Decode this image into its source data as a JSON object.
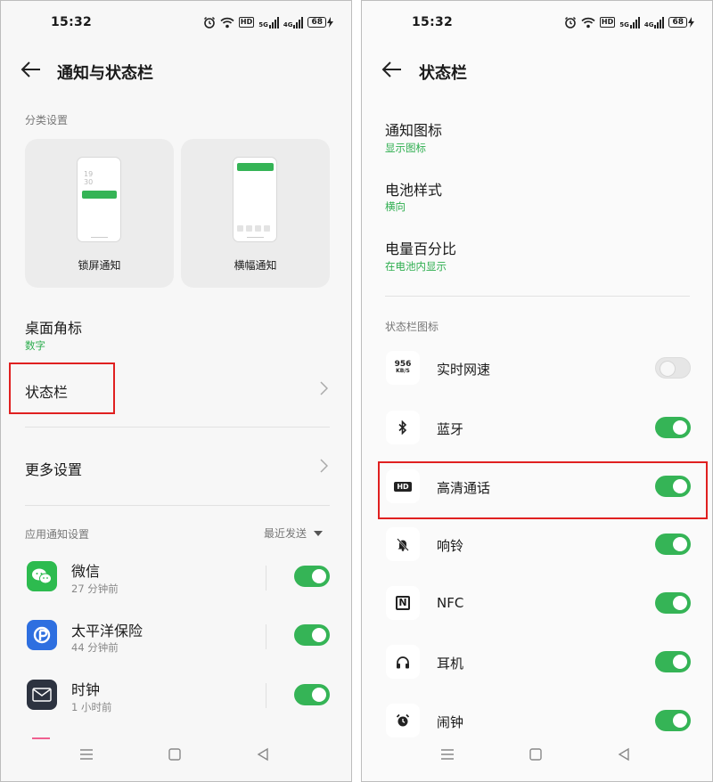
{
  "status": {
    "time": "15:32",
    "battery": "68",
    "hd": "HD",
    "sig1": "5G",
    "sig2": "4G"
  },
  "left": {
    "title": "通知与状态栏",
    "category_label": "分类设置",
    "cards": [
      {
        "label": "锁屏通知",
        "clock_top": "19",
        "clock_bottom": "30"
      },
      {
        "label": "横幅通知"
      }
    ],
    "badge": {
      "title": "桌面角标",
      "value": "数字"
    },
    "statusbar_item": "状态栏",
    "more_settings": "更多设置",
    "app_notif_label": "应用通知设置",
    "sort_label": "最近发送",
    "apps": [
      {
        "name": "微信",
        "time": "27 分钟前",
        "enabled": true,
        "icon": "wechat-icon",
        "color": "#2dbb4f"
      },
      {
        "name": "太平洋保险",
        "time": "44 分钟前",
        "enabled": true,
        "icon": "cpic-icon",
        "color": "#2e6fe0"
      },
      {
        "name": "时钟",
        "time": "1 小时前",
        "enabled": true,
        "icon": "clock-app-icon",
        "color": "#2d3340"
      }
    ]
  },
  "right": {
    "title": "状态栏",
    "items": [
      {
        "title": "通知图标",
        "value": "显示图标"
      },
      {
        "title": "电池样式",
        "value": "横向"
      },
      {
        "title": "电量百分比",
        "value": "在电池内显示"
      }
    ],
    "icons_label": "状态栏图标",
    "speed_icon_top": "956",
    "speed_icon_bottom": "KB/S",
    "hd_icon_text": "HD",
    "nfc_icon_text": "N",
    "toggles": [
      {
        "label": "实时网速",
        "enabled": false,
        "icon": "network-speed-icon"
      },
      {
        "label": "蓝牙",
        "enabled": true,
        "icon": "bluetooth-icon"
      },
      {
        "label": "高清通话",
        "enabled": true,
        "icon": "hd-call-icon"
      },
      {
        "label": "响铃",
        "enabled": true,
        "icon": "ringer-mute-icon"
      },
      {
        "label": "NFC",
        "enabled": true,
        "icon": "nfc-icon"
      },
      {
        "label": "耳机",
        "enabled": true,
        "icon": "headphones-icon"
      },
      {
        "label": "闹钟",
        "enabled": true,
        "icon": "alarm-icon"
      }
    ]
  },
  "colors": {
    "accent": "#35b456",
    "highlight": "#e02020",
    "subtext_green": "#2eae4f"
  }
}
